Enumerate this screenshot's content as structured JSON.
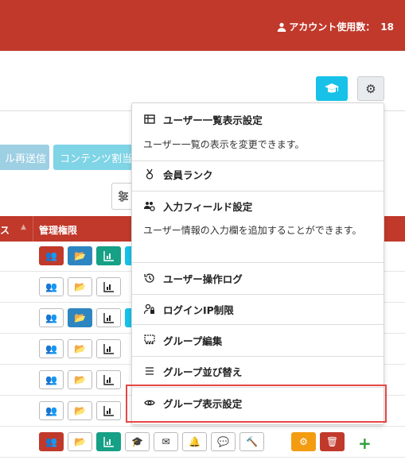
{
  "header": {
    "account_label": "アカウント使用数：",
    "account_count": "18"
  },
  "toolbar": {
    "resend_label": "ル再送信",
    "content_label": "コンテンツ割当"
  },
  "table": {
    "col_status": "ス",
    "col_admin": "管理権限"
  },
  "dropdown": {
    "items": [
      {
        "label": "ユーザー一覧表示設定",
        "icon": "table-icon",
        "desc": "ユーザー一覧の表示を変更できます。"
      },
      {
        "label": "会員ランク",
        "icon": "medal-icon"
      },
      {
        "label": "入力フィールド設定",
        "icon": "users-cog-icon",
        "desc": "ユーザー情報の入力欄を追加することができます。"
      },
      {
        "label": "ユーザー操作ログ",
        "icon": "history-icon"
      },
      {
        "label": "ログインIP制限",
        "icon": "user-lock-icon"
      },
      {
        "label": "グループ編集",
        "icon": "group-icon"
      },
      {
        "label": "グループ並び替え",
        "icon": "bars-icon"
      },
      {
        "label": "グループ表示設定",
        "icon": "eye-icon"
      }
    ]
  },
  "colors": {
    "brand": "#c0392b",
    "info": "#17c1e8",
    "primary": "#2e86c1",
    "success": "#16a085",
    "warning": "#f39c12",
    "highlight": "#e84545"
  }
}
